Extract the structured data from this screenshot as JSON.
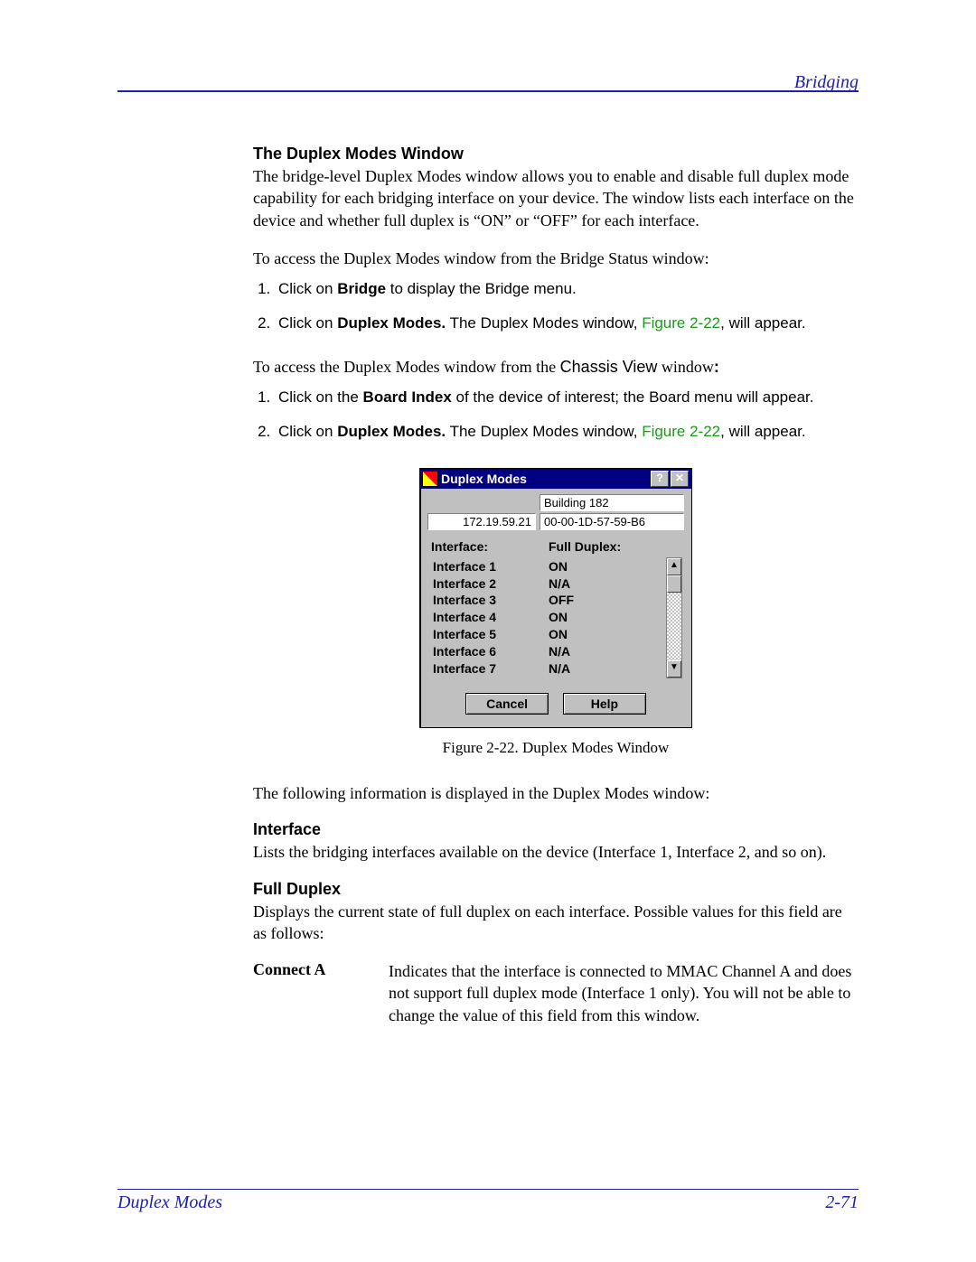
{
  "header": {
    "right": "Bridging"
  },
  "section": {
    "title": "The Duplex Modes Window",
    "p1": "The bridge-level Duplex Modes window allows you to enable and disable full duplex mode capability for each bridging interface on your device. The window lists each interface on the device and whether full duplex is “ON” or “OFF” for each interface.",
    "p2": "To access the Duplex Modes window from the Bridge Status window:",
    "steps1": [
      {
        "pre": "Click on ",
        "bold": "Bridge",
        "post": " to display the Bridge menu."
      },
      {
        "pre": "Click on ",
        "bold": "Duplex Modes.",
        "post": " The Duplex Modes window, ",
        "link": "Figure 2-22",
        "tail": ", will appear."
      }
    ],
    "p3_pre": "To access the Duplex Modes window from the ",
    "p3_sans": "Chassis View",
    "p3_post": " window",
    "p3_colon": ":",
    "steps2": [
      {
        "pre": "Click on the ",
        "bold": "Board Index",
        "post": " of the device of interest; the Board menu will appear."
      },
      {
        "pre": "Click on ",
        "bold": "Duplex Modes.",
        "post": " The Duplex Modes window, ",
        "link": "Figure 2-22",
        "tail": ", will appear."
      }
    ]
  },
  "dialog": {
    "title": "Duplex Modes",
    "help_icon": "?",
    "close_icon": "✕",
    "name": "Building 182",
    "ip": "172.19.59.21",
    "mac": "00-00-1D-57-59-B6",
    "label_interface": "Interface:",
    "label_fullduplex": "Full Duplex:",
    "rows": [
      {
        "iface": "Interface 1",
        "val": "ON"
      },
      {
        "iface": "Interface 2",
        "val": "N/A"
      },
      {
        "iface": "Interface 3",
        "val": "OFF"
      },
      {
        "iface": "Interface 4",
        "val": "ON"
      },
      {
        "iface": "Interface 5",
        "val": "ON"
      },
      {
        "iface": "Interface 6",
        "val": "N/A"
      },
      {
        "iface": "Interface 7",
        "val": "N/A"
      }
    ],
    "scroll_up": "▲",
    "scroll_down": "▼",
    "btn_cancel": "Cancel",
    "btn_help": "Help"
  },
  "figure_caption": "Figure 2-22. Duplex Modes Window",
  "after_fig": {
    "p1": "The following information is displayed in the Duplex Modes window:",
    "h_interface": "Interface",
    "p_interface": "Lists the bridging interfaces available on the device (Interface 1, Interface 2, and so on).",
    "h_fullduplex": "Full Duplex",
    "p_fullduplex": "Displays the current state of full duplex on each interface. Possible values for this field are as follows:",
    "term1": "Connect A",
    "def1": "Indicates that the interface is connected to MMAC Channel A and does not support full duplex mode (Interface 1 only). You will not be able to change the value of this field from this window."
  },
  "footer": {
    "left": "Duplex Modes",
    "right": "2-71"
  }
}
